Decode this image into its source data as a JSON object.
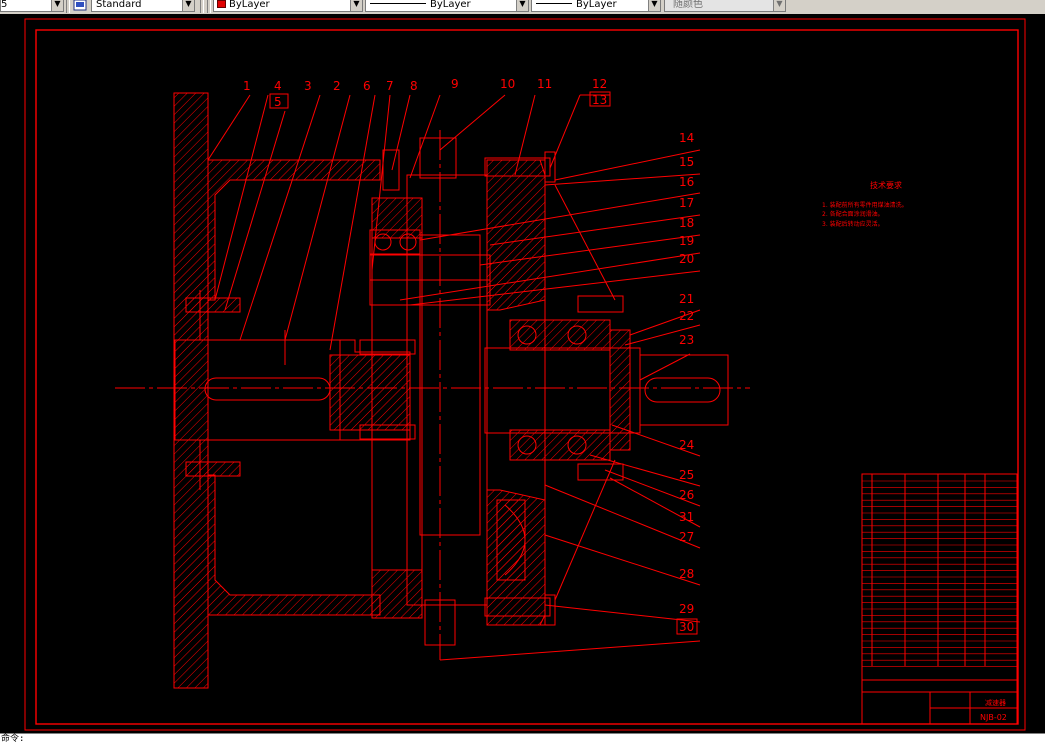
{
  "toolbar": {
    "partial_left_text": "5",
    "text_style": "Standard",
    "color": "ByLayer",
    "linetype": "ByLayer",
    "lineweight": "ByLayer",
    "plot_style": "随颜色",
    "swatch_color": "#e00000"
  },
  "drawing": {
    "line_color": "#ff0000",
    "background": "#000000",
    "balloons": [
      "1",
      "4",
      "5",
      "3",
      "2",
      "6",
      "7",
      "8",
      "9",
      "10",
      "11",
      "12",
      "13",
      "14",
      "15",
      "16",
      "17",
      "18",
      "19",
      "20",
      "21",
      "22",
      "23",
      "24",
      "25",
      "26",
      "31",
      "27",
      "28",
      "29",
      "30"
    ],
    "notes_title": "技术要求",
    "notes": [
      "1. 装配前所有零件用煤油清洗。",
      "2. 各配合面涂润滑油。",
      "3. 装配后转动应灵活。"
    ],
    "title_block": {
      "drawing_name": "减速器",
      "drawing_number": "NJB-02"
    }
  },
  "command_line": {
    "prompt": "命令:"
  }
}
